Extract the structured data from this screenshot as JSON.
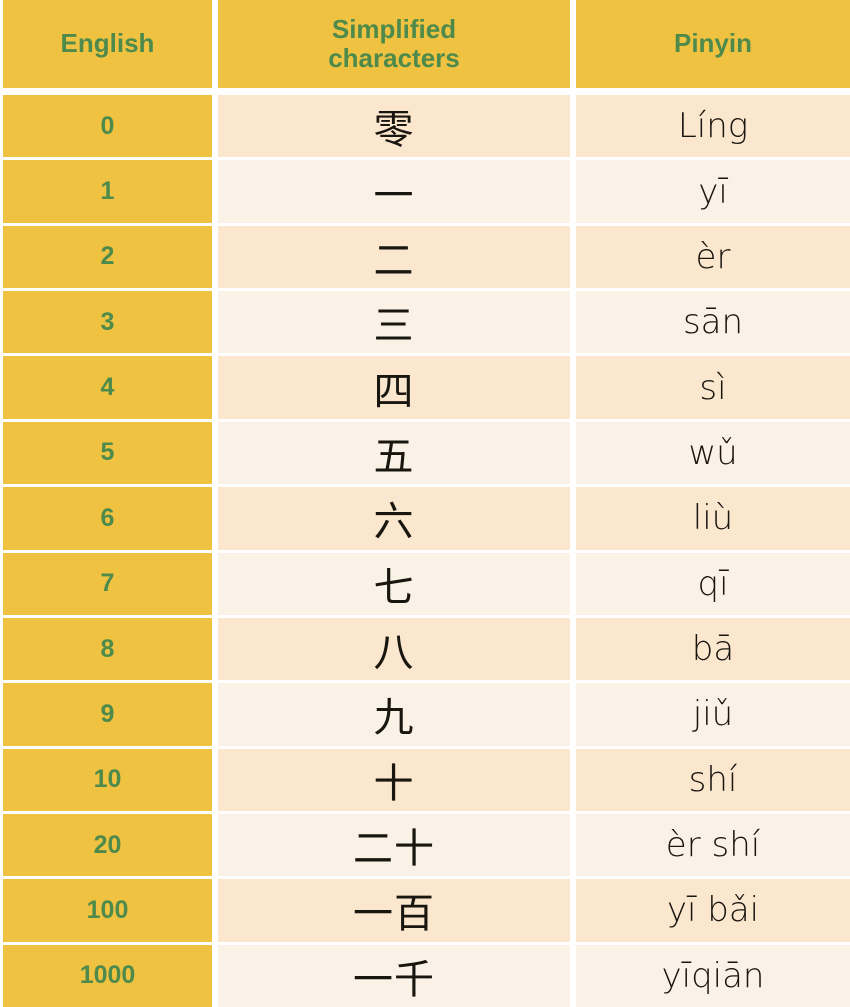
{
  "table": {
    "columns": [
      {
        "key": "english",
        "label": "English"
      },
      {
        "key": "simplified",
        "label_line1": "Simplified",
        "label_line2": "characters"
      },
      {
        "key": "pinyin",
        "label": "Pinyin"
      }
    ],
    "colors": {
      "header_background": "#efc241",
      "header_text": "#4d8a4b",
      "first_column_background": "#efc241",
      "first_column_text": "#4d8a4b",
      "row_background_odd": "#fbe6ce",
      "row_background_even": "#fbf2e7",
      "cell_text": "#19150f",
      "gridline": "#ffffff"
    },
    "rows": [
      {
        "english": "0",
        "simplified": "零",
        "pinyin": "Líng"
      },
      {
        "english": "1",
        "simplified": "一",
        "pinyin": "yī"
      },
      {
        "english": "2",
        "simplified": "二",
        "pinyin": "èr"
      },
      {
        "english": "3",
        "simplified": "三",
        "pinyin": "sān"
      },
      {
        "english": "4",
        "simplified": "四",
        "pinyin": "sì"
      },
      {
        "english": "5",
        "simplified": "五",
        "pinyin": "wǔ"
      },
      {
        "english": "6",
        "simplified": "六",
        "pinyin": "liù"
      },
      {
        "english": "7",
        "simplified": "七",
        "pinyin": "qī"
      },
      {
        "english": "8",
        "simplified": "八",
        "pinyin": "bā"
      },
      {
        "english": "9",
        "simplified": "九",
        "pinyin": "jiǔ"
      },
      {
        "english": "10",
        "simplified": "十",
        "pinyin": "shí"
      },
      {
        "english": "20",
        "simplified": "二十",
        "pinyin": "èr shí"
      },
      {
        "english": "100",
        "simplified": "一百",
        "pinyin": "yī bǎi"
      },
      {
        "english": "1000",
        "simplified": "一千",
        "pinyin": "yīqiān"
      }
    ]
  }
}
